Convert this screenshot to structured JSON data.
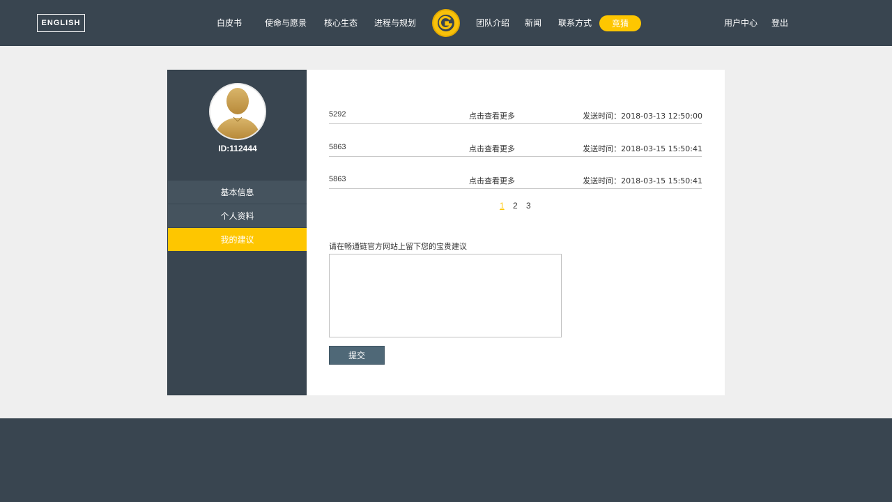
{
  "header": {
    "lang_button": "ENGLISH",
    "nav": [
      "白皮书",
      "使命与愿景",
      "核心生态",
      "进程与规划",
      "团队介绍",
      "新闻",
      "联系方式"
    ],
    "guess_button": "竞猜",
    "user_center": "用户中心",
    "logout": "登出"
  },
  "sidebar": {
    "user_id": "ID:112444",
    "menu": [
      {
        "label": "基本信息",
        "state": "normal"
      },
      {
        "label": "个人资料",
        "state": "normal"
      },
      {
        "label": "我的建议",
        "state": "active"
      }
    ]
  },
  "messages": [
    {
      "id": "5292",
      "more": "点击查看更多",
      "time": "发送时间：2018-03-13 12:50:00"
    },
    {
      "id": "5863",
      "more": "点击查看更多",
      "time": "发送时间：2018-03-15 15:50:41"
    },
    {
      "id": "5863",
      "more": "点击查看更多",
      "time": "发送时间：2018-03-15 15:50:41"
    }
  ],
  "pagination": {
    "pages": [
      "1",
      "2",
      "3"
    ],
    "current": "1"
  },
  "suggestion": {
    "label": "请在畅通链官方网站上留下您的宝贵建议",
    "value": "",
    "submit": "提交"
  },
  "colors": {
    "header_bg": "#394550",
    "accent": "#fec600",
    "sidebar_bg": "#394550",
    "menu_item_bg": "#45535e",
    "submit_bg": "#4f6877",
    "page_bg": "#efefef"
  },
  "icons": {
    "logo": "g-logo-icon",
    "avatar": "user-avatar-icon"
  }
}
